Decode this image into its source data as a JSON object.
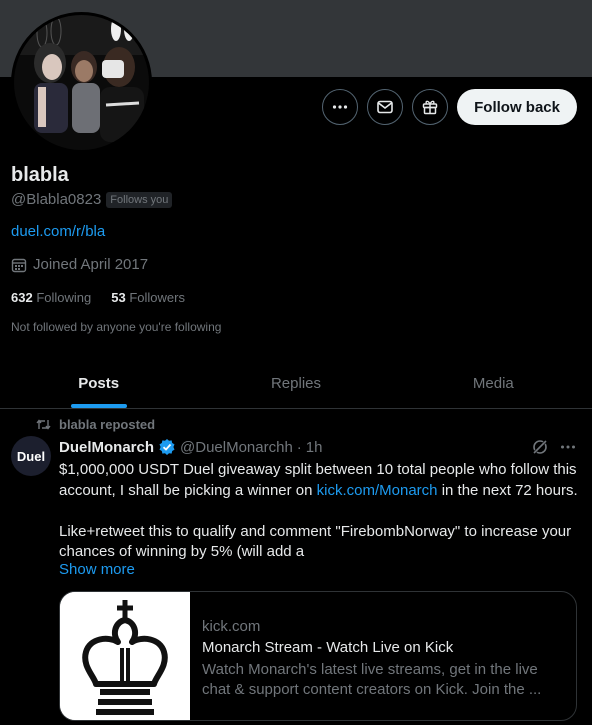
{
  "profile": {
    "display_name": "blabla",
    "handle": "@Blabla0823",
    "follows_you": "Follows you",
    "link": "duel.com/r/bla",
    "joined": "Joined April 2017",
    "following_count": "632",
    "following_label": "Following",
    "followers_count": "53",
    "followers_label": "Followers",
    "not_followed": "Not followed by anyone you're following"
  },
  "actions": {
    "more_icon": "more-icon",
    "message_icon": "mail-icon",
    "gift_icon": "gift-icon",
    "follow_back": "Follow back"
  },
  "tabs": [
    {
      "label": "Posts",
      "active": true
    },
    {
      "label": "Replies",
      "active": false
    },
    {
      "label": "Media",
      "active": false
    }
  ],
  "post": {
    "repost_label": "blabla reposted",
    "avatar_text": "Duel",
    "author_name": "DuelMonarch",
    "author_handle": "@DuelMonarchh",
    "dot": "·",
    "time": "1h",
    "body_1": "$1,000,000 USDT Duel giveaway split between 10 total people who follow this account, I shall be picking a winner on ",
    "body_link": "kick.com/Monarch",
    "body_2": " in the next 72 hours.",
    "body_3": "Like+retweet this to qualify and comment \"FirebombNorway\" to increase your chances of winning by 5% (will add a",
    "show_more": "Show more",
    "card": {
      "domain": "kick.com",
      "title": "Monarch Stream - Watch Live on Kick",
      "description": "Watch Monarch's latest live streams, get in the live chat & support content creators on Kick. Join the ..."
    }
  },
  "colors": {
    "accent": "#1d9bf0",
    "background": "#000000",
    "secondary_text": "#71767b",
    "verified": "#1d9bf0"
  }
}
